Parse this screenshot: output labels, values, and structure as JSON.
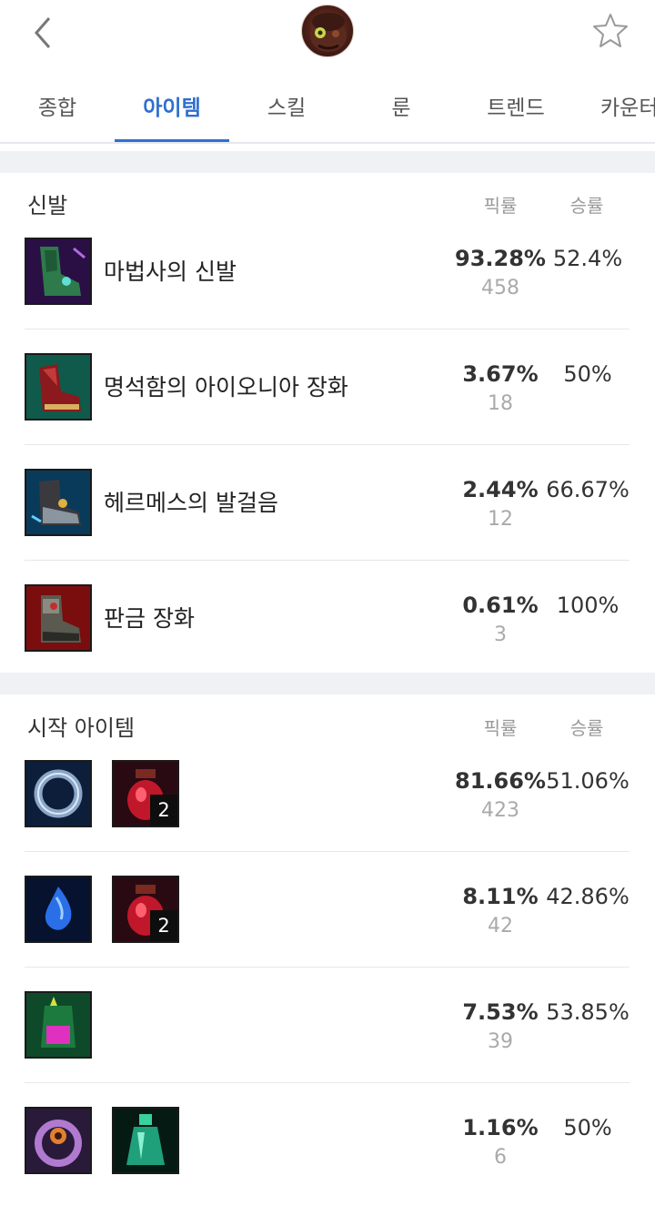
{
  "tabs": [
    {
      "label": "종합"
    },
    {
      "label": "아이템"
    },
    {
      "label": "스킬"
    },
    {
      "label": "룬"
    },
    {
      "label": "트렌드"
    },
    {
      "label": "카운터"
    }
  ],
  "active_tab": "아이템",
  "columns": {
    "pick": "픽률",
    "win": "승률"
  },
  "boots": {
    "title": "신발",
    "rows": [
      {
        "name": "마법사의 신발",
        "pick": "93.28%",
        "count": "458",
        "win": "52.4%",
        "icon": "sorcerers-shoes-icon"
      },
      {
        "name": "명석함의 아이오니아 장화",
        "pick": "3.67%",
        "count": "18",
        "win": "50%",
        "icon": "ionian-boots-icon"
      },
      {
        "name": "헤르메스의 발걸음",
        "pick": "2.44%",
        "count": "12",
        "win": "66.67%",
        "icon": "mercurys-treads-icon"
      },
      {
        "name": "판금 장화",
        "pick": "0.61%",
        "count": "3",
        "win": "100%",
        "icon": "plated-steelcaps-icon"
      }
    ]
  },
  "starting": {
    "title": "시작 아이템",
    "rows": [
      {
        "pick": "81.66%",
        "count": "423",
        "win": "51.06%",
        "items": [
          {
            "icon": "dorans-ring-icon"
          },
          {
            "icon": "health-potion-icon",
            "qty": "2"
          }
        ]
      },
      {
        "pick": "8.11%",
        "count": "42",
        "win": "42.86%",
        "items": [
          {
            "icon": "tear-of-the-goddess-icon"
          },
          {
            "icon": "health-potion-icon",
            "qty": "2"
          }
        ]
      },
      {
        "pick": "7.53%",
        "count": "39",
        "win": "53.85%",
        "items": [
          {
            "icon": "corrupting-potion-icon"
          }
        ]
      },
      {
        "pick": "1.16%",
        "count": "6",
        "win": "50%",
        "items": [
          {
            "icon": "dark-seal-icon"
          },
          {
            "icon": "refillable-potion-icon"
          }
        ]
      }
    ]
  },
  "colors": {
    "accent": "#2f6fcf",
    "muted": "#999999",
    "divider": "#e7e7ea"
  }
}
